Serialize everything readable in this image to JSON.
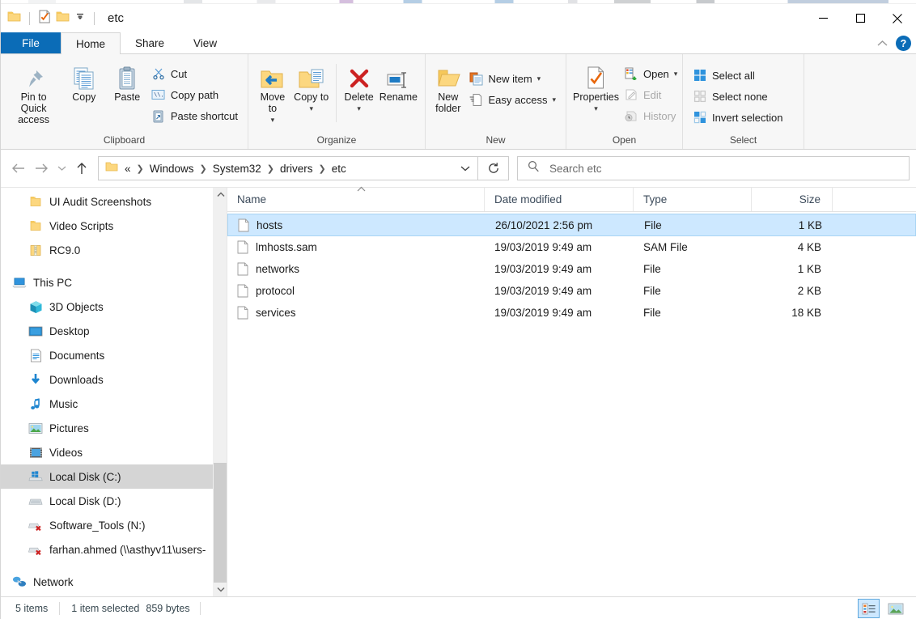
{
  "window": {
    "title": "etc",
    "quick_access": [
      "folder-icon",
      "properties-icon",
      "new-folder-icon",
      "customize-dropdown-icon"
    ],
    "controls": {
      "minimize": "minimize-icon",
      "maximize": "maximize-icon",
      "close": "close-icon"
    },
    "help_label": "?",
    "collapse_ribbon": "chevron-up-icon"
  },
  "tabs": [
    {
      "label": "File",
      "state": "file"
    },
    {
      "label": "Home",
      "state": "active"
    },
    {
      "label": "Share",
      "state": "normal"
    },
    {
      "label": "View",
      "state": "normal"
    }
  ],
  "ribbon": {
    "groups": [
      {
        "label": "Clipboard",
        "big": [
          {
            "label": "Pin to Quick access",
            "icon": "pin-icon"
          },
          {
            "label": "Copy",
            "icon": "copy-icon"
          },
          {
            "label": "Paste",
            "icon": "paste-icon"
          }
        ],
        "small": [
          {
            "label": "Cut",
            "icon": "scissors-icon",
            "disabled": false
          },
          {
            "label": "Copy path",
            "icon": "copy-path-icon",
            "disabled": false
          },
          {
            "label": "Paste shortcut",
            "icon": "paste-shortcut-icon",
            "disabled": false
          }
        ]
      },
      {
        "label": "Organize",
        "big": [
          {
            "label": "Move to",
            "icon": "move-to-icon",
            "caret": true
          },
          {
            "label": "Copy to",
            "icon": "copy-to-icon",
            "caret": true
          },
          {
            "label": "Delete",
            "icon": "delete-icon",
            "caret": true
          },
          {
            "label": "Rename",
            "icon": "rename-icon"
          }
        ],
        "small": []
      },
      {
        "label": "New",
        "big": [
          {
            "label": "New folder",
            "icon": "new-folder-icon"
          }
        ],
        "small": [
          {
            "label": "New item",
            "icon": "new-item-icon",
            "caret": true
          },
          {
            "label": "Easy access",
            "icon": "easy-access-icon",
            "caret": true
          }
        ]
      },
      {
        "label": "Open",
        "big": [
          {
            "label": "Properties",
            "icon": "properties-icon",
            "caret": true
          }
        ],
        "small": [
          {
            "label": "Open",
            "icon": "open-icon",
            "caret": true,
            "disabled": false
          },
          {
            "label": "Edit",
            "icon": "edit-icon",
            "disabled": true
          },
          {
            "label": "History",
            "icon": "history-icon",
            "disabled": true
          }
        ]
      },
      {
        "label": "Select",
        "big": [],
        "small": [
          {
            "label": "Select all",
            "icon": "select-all-icon"
          },
          {
            "label": "Select none",
            "icon": "select-none-icon"
          },
          {
            "label": "Invert selection",
            "icon": "invert-selection-icon"
          }
        ]
      }
    ]
  },
  "address": {
    "back": "back-arrow-icon",
    "forward": "forward-arrow-icon",
    "recent": "chevron-down-icon",
    "up": "up-arrow-icon",
    "folder_icon": "folder-icon",
    "prefix": "«",
    "crumbs": [
      "Windows",
      "System32",
      "drivers",
      "etc"
    ],
    "dropdown": "chevron-down-icon",
    "refresh": "refresh-icon"
  },
  "search": {
    "icon": "search-icon",
    "placeholder": "Search etc",
    "value": ""
  },
  "sidebar": {
    "items": [
      {
        "label": "UI Audit Screenshots",
        "icon": "folder-icon",
        "level": 1,
        "selected": false
      },
      {
        "label": "Video Scripts",
        "icon": "folder-icon",
        "level": 1,
        "selected": false
      },
      {
        "label": "RC9.0",
        "icon": "zip-folder-icon",
        "level": 1,
        "selected": false
      },
      {
        "gap": true
      },
      {
        "label": "This PC",
        "icon": "this-pc-icon",
        "level": 0,
        "selected": false
      },
      {
        "label": "3D Objects",
        "icon": "3d-objects-icon",
        "level": 1,
        "selected": false
      },
      {
        "label": "Desktop",
        "icon": "desktop-icon",
        "level": 1,
        "selected": false
      },
      {
        "label": "Documents",
        "icon": "documents-icon",
        "level": 1,
        "selected": false
      },
      {
        "label": "Downloads",
        "icon": "downloads-icon",
        "level": 1,
        "selected": false
      },
      {
        "label": "Music",
        "icon": "music-icon",
        "level": 1,
        "selected": false
      },
      {
        "label": "Pictures",
        "icon": "pictures-icon",
        "level": 1,
        "selected": false
      },
      {
        "label": "Videos",
        "icon": "videos-icon",
        "level": 1,
        "selected": false
      },
      {
        "label": "Local Disk (C:)",
        "icon": "local-disk-windows-icon",
        "level": 1,
        "selected": true
      },
      {
        "label": "Local Disk (D:)",
        "icon": "disk-drive-icon",
        "level": 1,
        "selected": false
      },
      {
        "label": "Software_Tools (N:)",
        "icon": "disconnected-network-drive-icon",
        "level": 1,
        "selected": false
      },
      {
        "label": "farhan.ahmed (\\\\asthyv11\\users-",
        "icon": "disconnected-network-drive-icon",
        "level": 1,
        "selected": false
      },
      {
        "gap": true
      },
      {
        "label": "Network",
        "icon": "network-icon",
        "level": 0,
        "selected": false
      }
    ],
    "scroll_up": "chevron-up-icon",
    "scroll_down": "chevron-down-icon"
  },
  "filelist": {
    "columns": [
      {
        "key": "name",
        "label": "Name",
        "sorted": true,
        "sort_icon": "sort-ascending-icon"
      },
      {
        "key": "date",
        "label": "Date modified"
      },
      {
        "key": "type",
        "label": "Type"
      },
      {
        "key": "size",
        "label": "Size"
      }
    ],
    "rows": [
      {
        "name": "hosts",
        "date": "26/10/2021 2:56 pm",
        "type": "File",
        "size": "1 KB",
        "selected": true
      },
      {
        "name": "lmhosts.sam",
        "date": "19/03/2019 9:49 am",
        "type": "SAM File",
        "size": "4 KB",
        "selected": false
      },
      {
        "name": "networks",
        "date": "19/03/2019 9:49 am",
        "type": "File",
        "size": "1 KB",
        "selected": false
      },
      {
        "name": "protocol",
        "date": "19/03/2019 9:49 am",
        "type": "File",
        "size": "2 KB",
        "selected": false
      },
      {
        "name": "services",
        "date": "19/03/2019 9:49 am",
        "type": "File",
        "size": "18 KB",
        "selected": false
      }
    ]
  },
  "statusbar": {
    "item_count": "5 items",
    "selection": "1 item selected",
    "selection_size": "859 bytes",
    "views": [
      {
        "name": "details-view",
        "active": true
      },
      {
        "name": "large-icons-view",
        "active": false
      }
    ]
  },
  "colors": {
    "accent_blue": "#0b6cb7",
    "selection_blue": "#cde8ff",
    "selection_border": "#a8d4f4",
    "nav_selected_gray": "#d5d5d5",
    "ribbon_bg": "#f7f7f7",
    "folder_yellow": "#fcd77f"
  }
}
